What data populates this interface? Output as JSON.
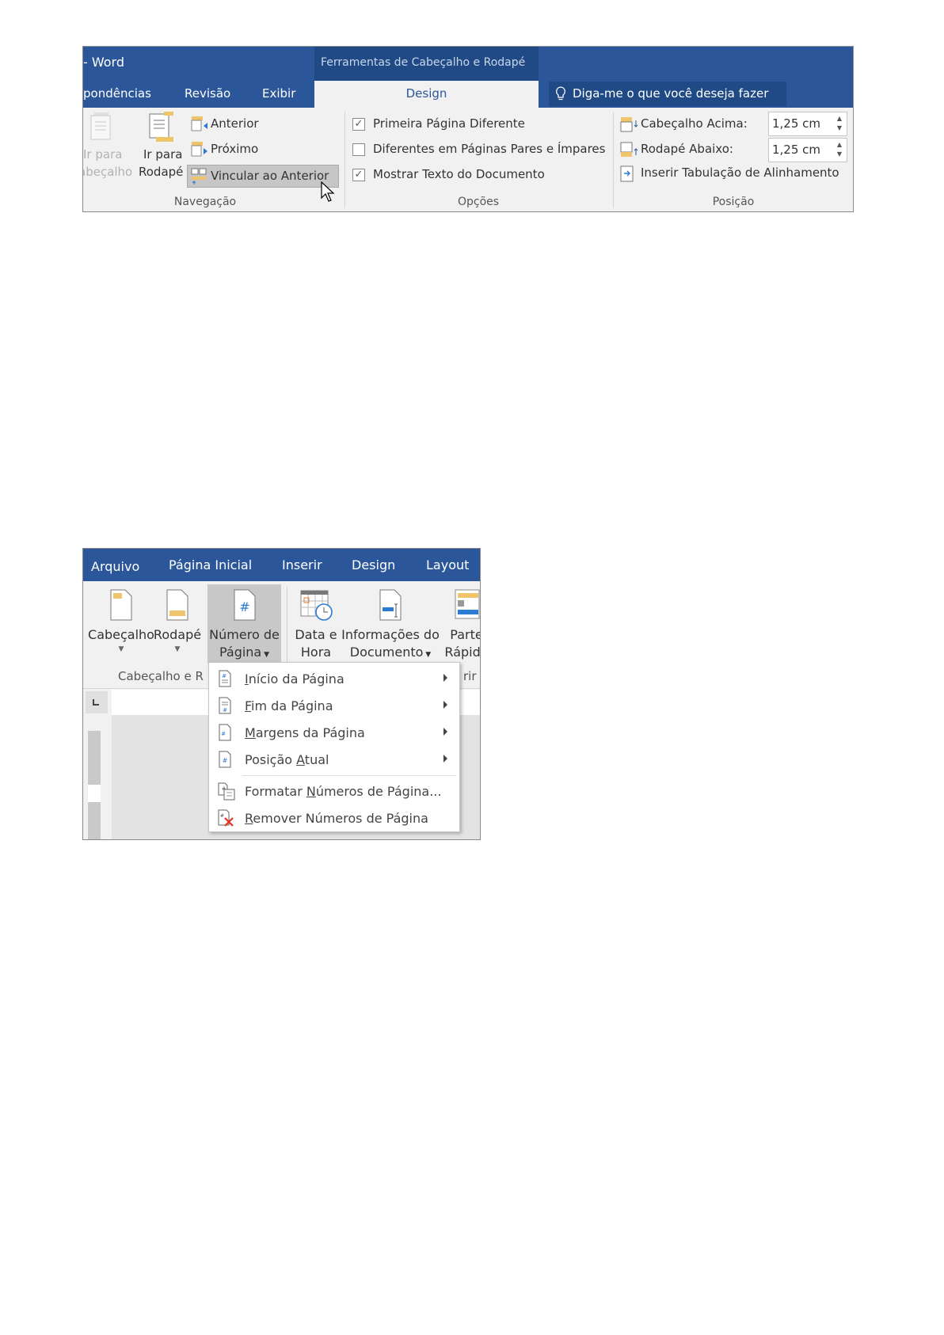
{
  "panel1": {
    "title": "- Word",
    "contextual_title": "Ferramentas de Cabeçalho e Rodapé",
    "tabs": [
      "pondências",
      "Revisão",
      "Exibir",
      "Design"
    ],
    "active_tab": "Design",
    "tell_me": "Diga-me o que você deseja fazer",
    "navegacao": {
      "label": "Navegação",
      "goto_header": [
        "Ir para",
        "abeçalho"
      ],
      "goto_footer": [
        "Ir para",
        "Rodapé"
      ],
      "anterior": "Anterior",
      "proximo": "Próximo",
      "vincular": "Vincular ao Anterior"
    },
    "opcoes": {
      "label": "Opções",
      "items": [
        {
          "label": "Primeira Página Diferente",
          "checked": true
        },
        {
          "label": "Diferentes em Páginas Pares e Ímpares",
          "checked": false
        },
        {
          "label": "Mostrar Texto do Documento",
          "checked": true
        }
      ]
    },
    "posicao": {
      "label": "Posição",
      "header_top": "Cabeçalho Acima:",
      "header_top_value": "1,25 cm",
      "footer_bottom": "Rodapé Abaixo:",
      "footer_bottom_value": "1,25 cm",
      "insert_tab": "Inserir Tabulação de Alinhamento"
    }
  },
  "panel2": {
    "tabs": [
      "Arquivo",
      "Página Inicial",
      "Inserir",
      "Design",
      "Layout"
    ],
    "buttons": {
      "cabecalho": "Cabeçalho",
      "rodape": "Rodapé",
      "numero": [
        "Número de",
        "Página"
      ],
      "data": [
        "Data e",
        "Hora"
      ],
      "info": [
        "Informações do",
        "Documento"
      ],
      "parte": [
        "Parte",
        "Rápida"
      ]
    },
    "group_label": "Cabeçalho e R",
    "group_label2": "rir",
    "menu": [
      {
        "pre": "",
        "u": "I",
        "post": "nício da Página",
        "submenu": true
      },
      {
        "pre": "",
        "u": "F",
        "post": "im da Página",
        "submenu": true
      },
      {
        "pre": "",
        "u": "M",
        "post": "argens da Página",
        "submenu": true
      },
      {
        "pre": "Posição ",
        "u": "A",
        "post": "tual",
        "submenu": true
      },
      {
        "pre": "Formatar ",
        "u": "N",
        "post": "úmeros de Página...",
        "submenu": false
      },
      {
        "pre": "",
        "u": "R",
        "post": "emover Números de Página",
        "submenu": false
      }
    ]
  },
  "colors": {
    "brand": "#2b579a",
    "contextual": "#1f4a85",
    "accent_text": "#2b579a",
    "icon_yellow": "#f0c36d",
    "remove_red": "#e8321e"
  }
}
